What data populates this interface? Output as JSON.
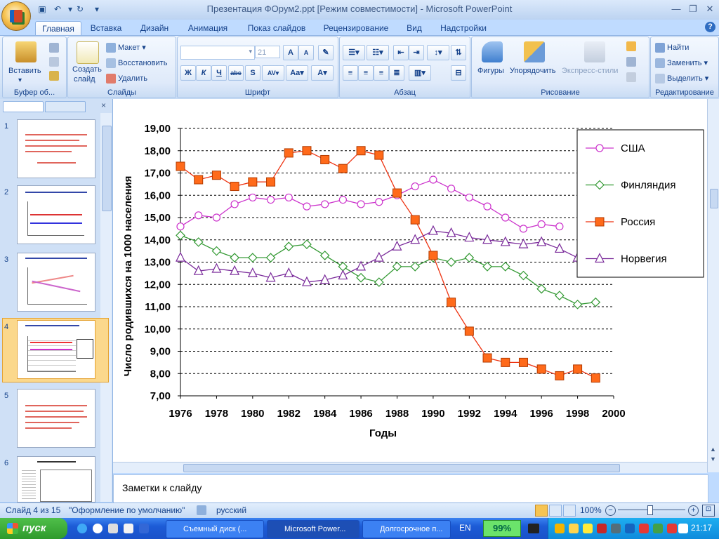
{
  "window": {
    "title": "Презентация ФОрум2.ppt [Режим совместимости] - Microsoft PowerPoint",
    "qat_save_icon": "save-icon",
    "qat_undo_icon": "undo-icon",
    "qat_redo_icon": "redo-icon"
  },
  "tabs": [
    "Главная",
    "Вставка",
    "Дизайн",
    "Анимация",
    "Показ слайдов",
    "Рецензирование",
    "Вид",
    "Надстройки"
  ],
  "ribbon": {
    "clipboard": {
      "paste": "Вставить",
      "label": "Буфер об..."
    },
    "slides": {
      "create": "Создать",
      "create2": "слайд",
      "layout": "Макет",
      "reset": "Восстановить",
      "delete": "Удалить",
      "label": "Слайды"
    },
    "font": {
      "size": "21",
      "label": "Шрифт"
    },
    "paragraph": {
      "label": "Абзац"
    },
    "drawing": {
      "shapes": "Фигуры",
      "arrange": "Упорядочить",
      "quick_styles": "Экспресс-стили",
      "label": "Рисование"
    },
    "editing": {
      "find": "Найти",
      "replace": "Заменить",
      "select": "Выделить",
      "label": "Редактирование"
    }
  },
  "slides_panel": {
    "thumbnails": [
      "1",
      "2",
      "3",
      "4",
      "5",
      "6"
    ],
    "selected": "4"
  },
  "notes": {
    "placeholder": "Заметки к слайду"
  },
  "status": {
    "slide": "Слайд 4 из 15",
    "theme": "\"Оформление по умолчанию\"",
    "language": "русский",
    "zoom": "100%"
  },
  "taskbar": {
    "start": "пуск",
    "tasks": [
      "Съемный диск (...",
      "Microsoft Power...",
      "Долгосрочное п..."
    ],
    "lang": "EN",
    "battery": "99%",
    "clock": "21:17"
  },
  "chart_data": {
    "type": "line",
    "x": [
      1976,
      1977,
      1978,
      1979,
      1980,
      1981,
      1982,
      1983,
      1984,
      1985,
      1986,
      1987,
      1988,
      1989,
      1990,
      1991,
      1992,
      1993,
      1994,
      1995,
      1996,
      1997,
      1998,
      1999
    ],
    "xlabel": "Годы",
    "ylabel": "Число родившихся на 1000 населения",
    "xlim": [
      1976,
      2000
    ],
    "ylim": [
      7,
      19
    ],
    "xticks": [
      "1976",
      "1978",
      "1980",
      "1982",
      "1984",
      "1986",
      "1988",
      "1990",
      "1992",
      "1994",
      "1996",
      "1998",
      "2000"
    ],
    "yticks": [
      "7,00",
      "8,00",
      "9,00",
      "10,00",
      "11,00",
      "12,00",
      "13,00",
      "14,00",
      "15,00",
      "16,00",
      "17,00",
      "18,00",
      "19,00"
    ],
    "grid": "horizontal dashed",
    "legend": "right",
    "series": [
      {
        "name": "США",
        "color": "#cc33cc",
        "marker": "circle",
        "values": [
          14.6,
          15.1,
          15.0,
          15.6,
          15.9,
          15.8,
          15.9,
          15.5,
          15.6,
          15.8,
          15.6,
          15.7,
          16.0,
          16.4,
          16.7,
          16.3,
          15.9,
          15.5,
          15.0,
          14.5,
          14.7,
          14.6,
          null,
          null
        ]
      },
      {
        "name": "Финляндия",
        "color": "#339933",
        "marker": "diamond",
        "values": [
          14.2,
          13.9,
          13.5,
          13.2,
          13.2,
          13.2,
          13.7,
          13.8,
          13.3,
          12.8,
          12.3,
          12.1,
          12.8,
          12.8,
          13.2,
          13.0,
          13.2,
          12.8,
          12.8,
          12.4,
          11.8,
          11.5,
          11.1,
          11.2
        ]
      },
      {
        "name": "Россия",
        "color": "#ee3311",
        "marker": "square",
        "values": [
          17.3,
          16.7,
          16.9,
          16.4,
          16.6,
          16.6,
          17.9,
          18.0,
          17.6,
          17.2,
          18.0,
          17.8,
          16.1,
          14.9,
          13.3,
          11.2,
          9.9,
          8.7,
          8.5,
          8.5,
          8.2,
          7.9,
          8.2,
          7.8
        ]
      },
      {
        "name": "Норвегия",
        "color": "#7a2a9a",
        "marker": "triangle",
        "values": [
          13.2,
          12.6,
          12.7,
          12.6,
          12.5,
          12.3,
          12.5,
          12.1,
          12.2,
          12.4,
          12.8,
          13.2,
          13.7,
          14.0,
          14.4,
          14.3,
          14.1,
          14.0,
          13.9,
          13.8,
          13.9,
          13.6,
          13.2,
          null
        ]
      }
    ]
  }
}
